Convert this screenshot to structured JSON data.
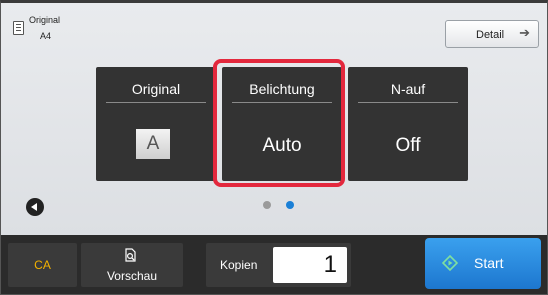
{
  "header": {
    "original_label": "Original",
    "original_size": "A4",
    "detail_label": "Detail"
  },
  "tiles": [
    {
      "title": "Original",
      "value": "A",
      "value_icon": "orientation-a-icon"
    },
    {
      "title": "Belichtung",
      "value": "Auto",
      "highlighted": true
    },
    {
      "title": "N-auf",
      "value": "Off"
    }
  ],
  "paging": {
    "pages": 2,
    "current": 2
  },
  "bottom": {
    "ca_label": "CA",
    "preview_label": "Vorschau",
    "copies_label": "Kopien",
    "copies_value": "1",
    "start_label": "Start"
  },
  "colors": {
    "highlight": "#e3283d",
    "ca_text": "#f3b200",
    "start": "#1d77cf",
    "active_dot": "#1a7fd6",
    "tile_bg": "#333333"
  }
}
